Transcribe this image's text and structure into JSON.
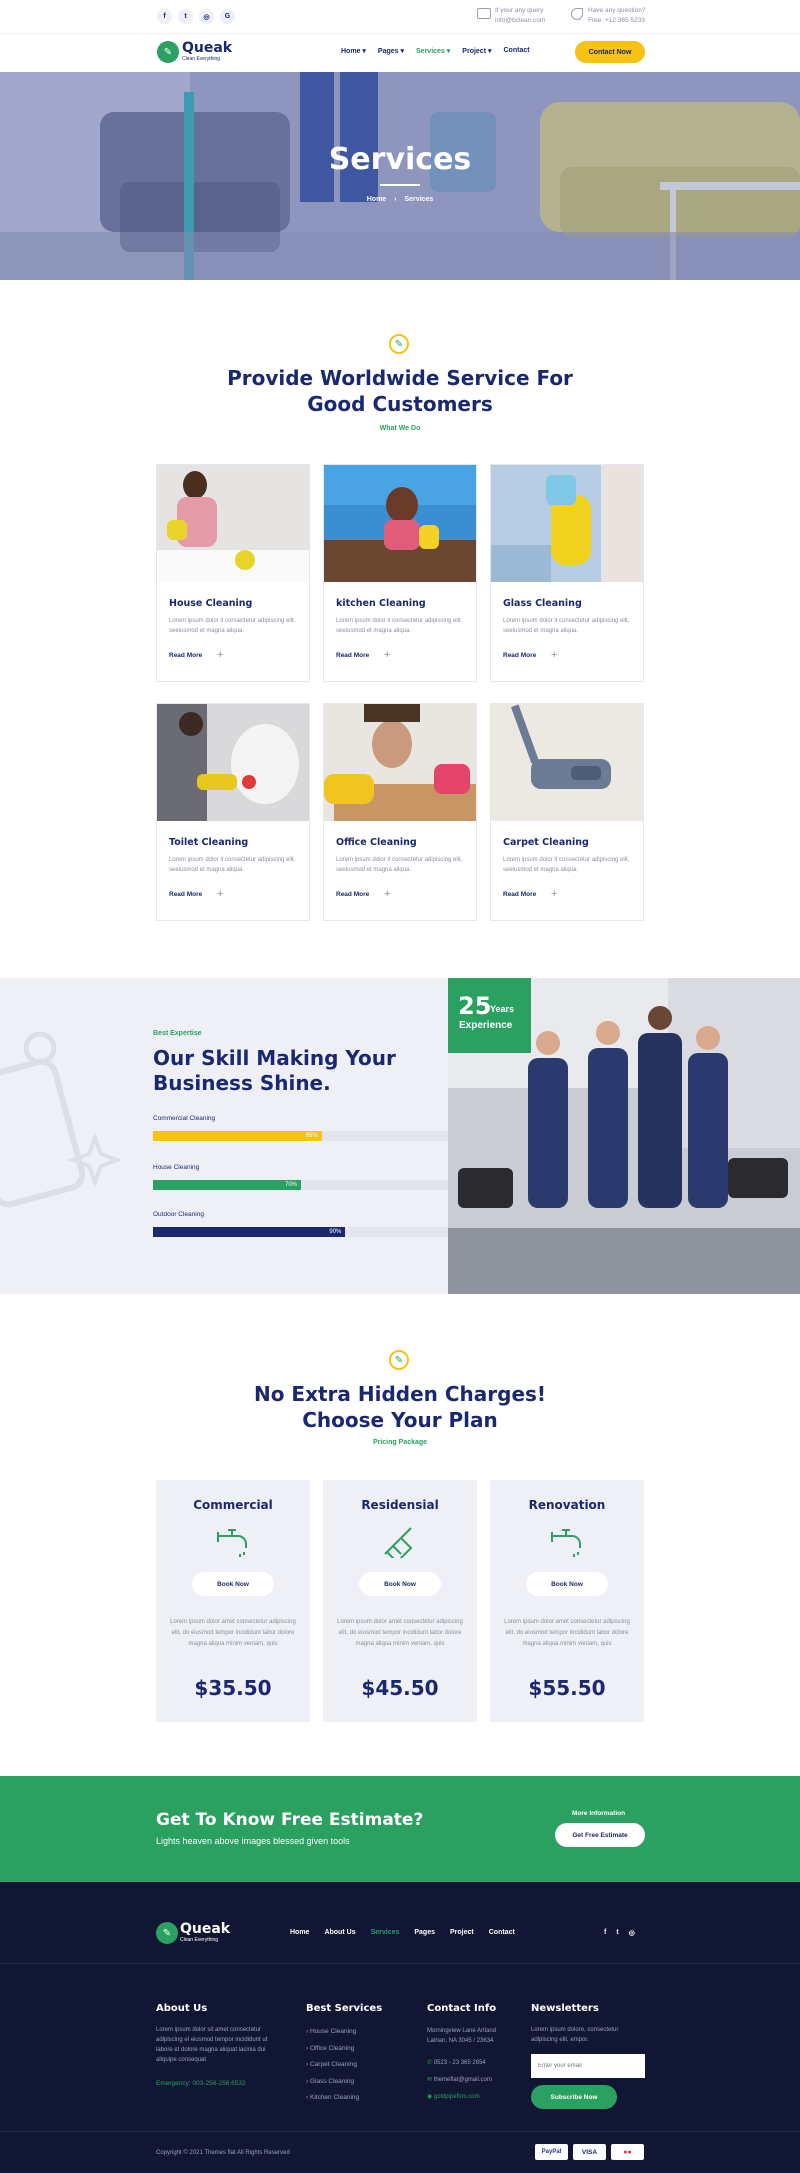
{
  "topbar": {
    "socials": [
      "f",
      "t",
      "◎",
      "G"
    ],
    "query_label": "If your any query",
    "query_value": "info@bclean.com",
    "question_label": "Have any question?",
    "question_value": "Free: +12 365 5233"
  },
  "header": {
    "logo_name": "Queak",
    "logo_tag": "Clean Everything",
    "nav": [
      "Home",
      "Pages",
      "Services",
      "Project",
      "Contact"
    ],
    "cta": "Contact Now"
  },
  "hero": {
    "title": "Services",
    "crumb_home": "Home",
    "crumb_sep": "›",
    "crumb_current": "Services"
  },
  "services": {
    "title_line1": "Provide Worldwide Service For",
    "title_line2": "Good Customers",
    "subtitle": "What We Do",
    "cards": [
      {
        "title": "House Cleaning",
        "desc": "Lorem ipsum dolor it consectetur adipiscing elit, seeiusmod et magna aliqua.",
        "more": "Read More"
      },
      {
        "title": "kitchen Cleaning",
        "desc": "Lorem ipsum dolor it consectetur adipiscing elit, seeiusmod et magna aliqua.",
        "more": "Read More"
      },
      {
        "title": "Glass Cleaning",
        "desc": "Lorem ipsum dolor it consectetur adipiscing elit, seeiusmod et magna aliqua.",
        "more": "Read More"
      },
      {
        "title": "Toilet Cleaning",
        "desc": "Lorem ipsum dolor it consectetur adipiscing elit, seeiusmod et magna aliqua.",
        "more": "Read More"
      },
      {
        "title": "Office Cleaning",
        "desc": "Lorem ipsum dolor it consectetur adipiscing elit, seeiusmod et magna aliqua.",
        "more": "Read More"
      },
      {
        "title": "Carpet Cleaning",
        "desc": "Lorem ipsum dolor it consectetur adipiscing elit, seeiusmod et magna aliqua.",
        "more": "Read More"
      }
    ]
  },
  "skills": {
    "eyebrow": "Best Expertise",
    "title_line1": "Our Skill Making Your",
    "title_line2": "Business Shine.",
    "bars": [
      {
        "label": "Commercial Cleaning",
        "value": "95%",
        "fraction": 0.57,
        "color": "#f7c213"
      },
      {
        "label": "House Cleaning",
        "value": "70%",
        "fraction": 0.5,
        "color": "#2aa160"
      },
      {
        "label": "Outdoor Cleaning",
        "value": "90%",
        "fraction": 0.65,
        "color": "#1a2870"
      }
    ],
    "years_num": "25",
    "years_word": "Years",
    "years_label": "Experience"
  },
  "pricing": {
    "title_line1": "No Extra Hidden Charges!",
    "title_line2": "Choose Your Plan",
    "subtitle": "Pricing Package",
    "plans": [
      {
        "name": "Commercial",
        "button": "Book Now",
        "desc": "Lorem ipsum dolor amet consectetur adipiscing elit, do eiusmod tempor incididunt labor dolore magna aliqua minim veniam, quis",
        "price": "$35.50"
      },
      {
        "name": "Residensial",
        "button": "Book Now",
        "desc": "Lorem ipsum dolor amet consectetur adipiscing elit, do eiusmod tempor incididunt labor dolore magna aliqua minim veniam, quis",
        "price": "$45.50"
      },
      {
        "name": "Renovation",
        "button": "Book Now",
        "desc": "Lorem ipsum dolor amet consectetur adipiscing elit, do eiusmod tempor incididunt labor dolore magna aliqua minim veniam, quis",
        "price": "$55.50"
      }
    ]
  },
  "cta": {
    "title": "Get To Know Free Estimate?",
    "subtitle": "Lights heaven above images blessed given tools",
    "more_label": "More Information",
    "button": "Get Free Estimate"
  },
  "footer": {
    "logo_name": "Queak",
    "logo_tag": "Clean Everything",
    "nav": [
      "Home",
      "About Us",
      "Services",
      "Pages",
      "Project",
      "Contact"
    ],
    "socials": [
      "f",
      "t",
      "◎"
    ],
    "about_title": "About Us",
    "about_text": "Lorem ipsum dolor sit amet consectetur adipiscing el eiusmod tempor incididunt ut labore et dolore magna aliquat lacinia dui aliquipe consequat",
    "emergency": "Emergency: 003-256-256 6532",
    "services_title": "Best Services",
    "services_links": [
      "House Cleaning",
      "Office Cleaning",
      "Carpet Cleaning",
      "Glass Cleaning",
      "Kitchen Cleaning"
    ],
    "contact_title": "Contact Info",
    "contact_address": "Morningview Lane Artland Latrian, NA 3045 / 23634",
    "contact_phone": "0523 - 23 365 2654",
    "contact_email": "themeflat@gmail.com",
    "contact_web": "goldpipefirm.com",
    "news_title": "Newsletters",
    "news_text": "Lorem ipsum dolore, consectetur adipiscing elit, empor.",
    "news_placeholder": "Enter your email",
    "news_button": "Subscribe Now",
    "copyright": "Copyright © 2021 Themes flat All Rights Reserved",
    "payments": [
      "PayPal",
      "VISA",
      "●●"
    ]
  }
}
